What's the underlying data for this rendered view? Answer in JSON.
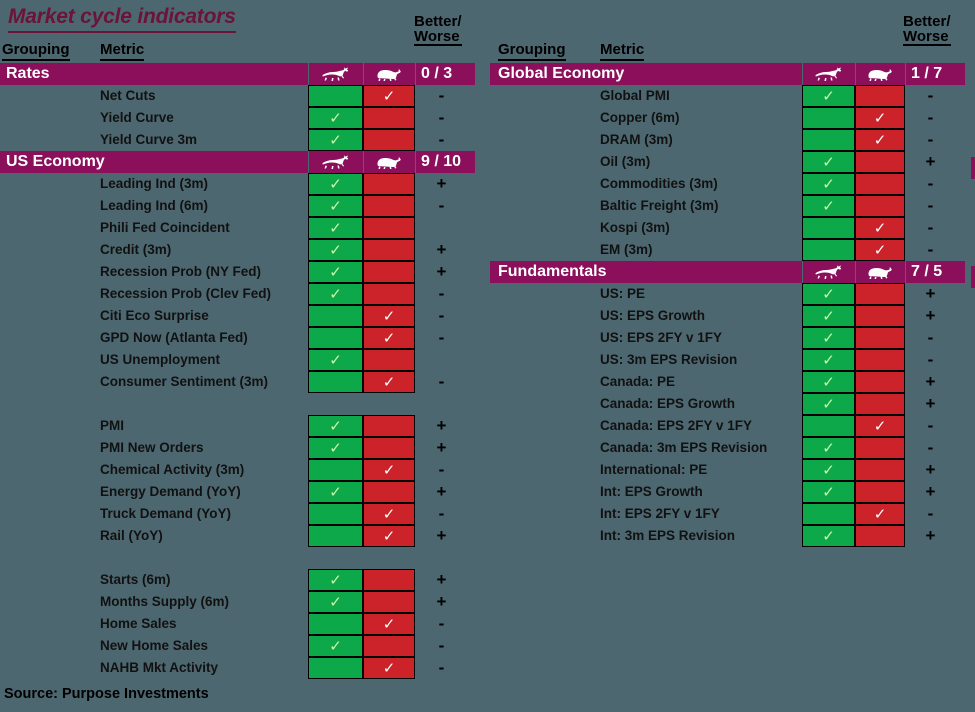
{
  "title": "Market cycle indicators",
  "source": "Source: Purpose Investments",
  "colors": {
    "background": "#4d6770",
    "band": "#8B0F5B",
    "bull": "#0CA84A",
    "bear": "#CC2229",
    "title": "#6b1338"
  },
  "headers": {
    "grouping": "Grouping",
    "metric": "Metric",
    "better": "Better/",
    "worse": "Worse",
    "bull_icon": "bull-icon",
    "bear_icon": "bear-icon"
  },
  "panels": [
    {
      "id": "left",
      "groups": [
        {
          "name": "Rates",
          "score": "0 / 3",
          "rows": [
            {
              "metric": "Net Cuts",
              "bull": false,
              "bear": true,
              "change": "-"
            },
            {
              "metric": "Yield Curve",
              "bull": true,
              "bear": false,
              "change": "-"
            },
            {
              "metric": "Yield Curve 3m",
              "bull": true,
              "bear": false,
              "change": "-"
            }
          ]
        },
        {
          "name": "US Economy",
          "score": "9 / 10",
          "rows": [
            {
              "metric": "Leading Ind (3m)",
              "bull": true,
              "bear": false,
              "change": "+"
            },
            {
              "metric": "Leading Ind (6m)",
              "bull": true,
              "bear": false,
              "change": "-"
            },
            {
              "metric": "Phili Fed Coincident",
              "bull": true,
              "bear": false,
              "change": ""
            },
            {
              "metric": "Credit (3m)",
              "bull": true,
              "bear": false,
              "change": "+"
            },
            {
              "metric": "Recession Prob (NY Fed)",
              "bull": true,
              "bear": false,
              "change": "+"
            },
            {
              "metric": "Recession Prob (Clev Fed)",
              "bull": true,
              "bear": false,
              "change": "-"
            },
            {
              "metric": "Citi Eco Surprise",
              "bull": false,
              "bear": true,
              "change": "-"
            },
            {
              "metric": "GPD Now (Atlanta Fed)",
              "bull": false,
              "bear": true,
              "change": "-"
            },
            {
              "metric": "US Unemployment",
              "bull": true,
              "bear": false,
              "change": ""
            },
            {
              "metric": "Consumer Sentiment (3m)",
              "bull": false,
              "bear": true,
              "change": "-"
            },
            {
              "spacer": true
            },
            {
              "metric": "PMI",
              "bull": true,
              "bear": false,
              "change": "+"
            },
            {
              "metric": "PMI New Orders",
              "bull": true,
              "bear": false,
              "change": "+"
            },
            {
              "metric": "Chemical Activity (3m)",
              "bull": false,
              "bear": true,
              "change": "-"
            },
            {
              "metric": "Energy Demand (YoY)",
              "bull": true,
              "bear": false,
              "change": "+"
            },
            {
              "metric": "Truck Demand (YoY)",
              "bull": false,
              "bear": true,
              "change": "-"
            },
            {
              "metric": "Rail (YoY)",
              "bull": false,
              "bear": true,
              "change": "+"
            },
            {
              "spacer": true
            },
            {
              "metric": "Starts (6m)",
              "bull": true,
              "bear": false,
              "change": "+"
            },
            {
              "metric": "Months Supply (6m)",
              "bull": true,
              "bear": false,
              "change": "+"
            },
            {
              "metric": "Home Sales",
              "bull": false,
              "bear": true,
              "change": "-"
            },
            {
              "metric": "New Home Sales",
              "bull": true,
              "bear": false,
              "change": "-"
            },
            {
              "metric": "NAHB Mkt Activity",
              "bull": false,
              "bear": true,
              "change": "-"
            }
          ]
        }
      ]
    },
    {
      "id": "right",
      "groups": [
        {
          "name": "Global Economy",
          "score": "1 / 7",
          "rows": [
            {
              "metric": "Global PMI",
              "bull": true,
              "bear": false,
              "change": "-"
            },
            {
              "metric": "Copper (6m)",
              "bull": false,
              "bear": true,
              "change": "-"
            },
            {
              "metric": "DRAM (3m)",
              "bull": false,
              "bear": true,
              "change": "-"
            },
            {
              "metric": "Oil (3m)",
              "bull": true,
              "bear": false,
              "change": "+"
            },
            {
              "metric": "Commodities (3m)",
              "bull": true,
              "bear": false,
              "change": "-"
            },
            {
              "metric": "Baltic Freight (3m)",
              "bull": true,
              "bear": false,
              "change": "-"
            },
            {
              "metric": "Kospi (3m)",
              "bull": false,
              "bear": true,
              "change": "-"
            },
            {
              "metric": "EM (3m)",
              "bull": false,
              "bear": true,
              "change": "-"
            }
          ]
        },
        {
          "name": "Fundamentals",
          "score": "7 / 5",
          "rows": [
            {
              "metric": "US: PE",
              "bull": true,
              "bear": false,
              "change": "+"
            },
            {
              "metric": "US: EPS Growth",
              "bull": true,
              "bear": false,
              "change": "+"
            },
            {
              "metric": "US: EPS 2FY v 1FY",
              "bull": true,
              "bear": false,
              "change": "-"
            },
            {
              "metric": "US: 3m EPS Revision",
              "bull": true,
              "bear": false,
              "change": "-"
            },
            {
              "metric": "Canada: PE",
              "bull": true,
              "bear": false,
              "change": "+"
            },
            {
              "metric": "Canada: EPS Growth",
              "bull": true,
              "bear": false,
              "change": "+"
            },
            {
              "metric": "Canada: EPS 2FY v 1FY",
              "bull": false,
              "bear": true,
              "change": "-"
            },
            {
              "metric": "Canada: 3m EPS Revision",
              "bull": true,
              "bear": false,
              "change": "-"
            },
            {
              "metric": "International: PE",
              "bull": true,
              "bear": false,
              "change": "+"
            },
            {
              "metric": "Int: EPS Growth",
              "bull": true,
              "bear": false,
              "change": "+"
            },
            {
              "metric": "Int: EPS 2FY v 1FY",
              "bull": false,
              "bear": true,
              "change": "-"
            },
            {
              "metric": "Int: 3m EPS Revision",
              "bull": true,
              "bear": false,
              "change": "+"
            }
          ]
        }
      ]
    }
  ]
}
